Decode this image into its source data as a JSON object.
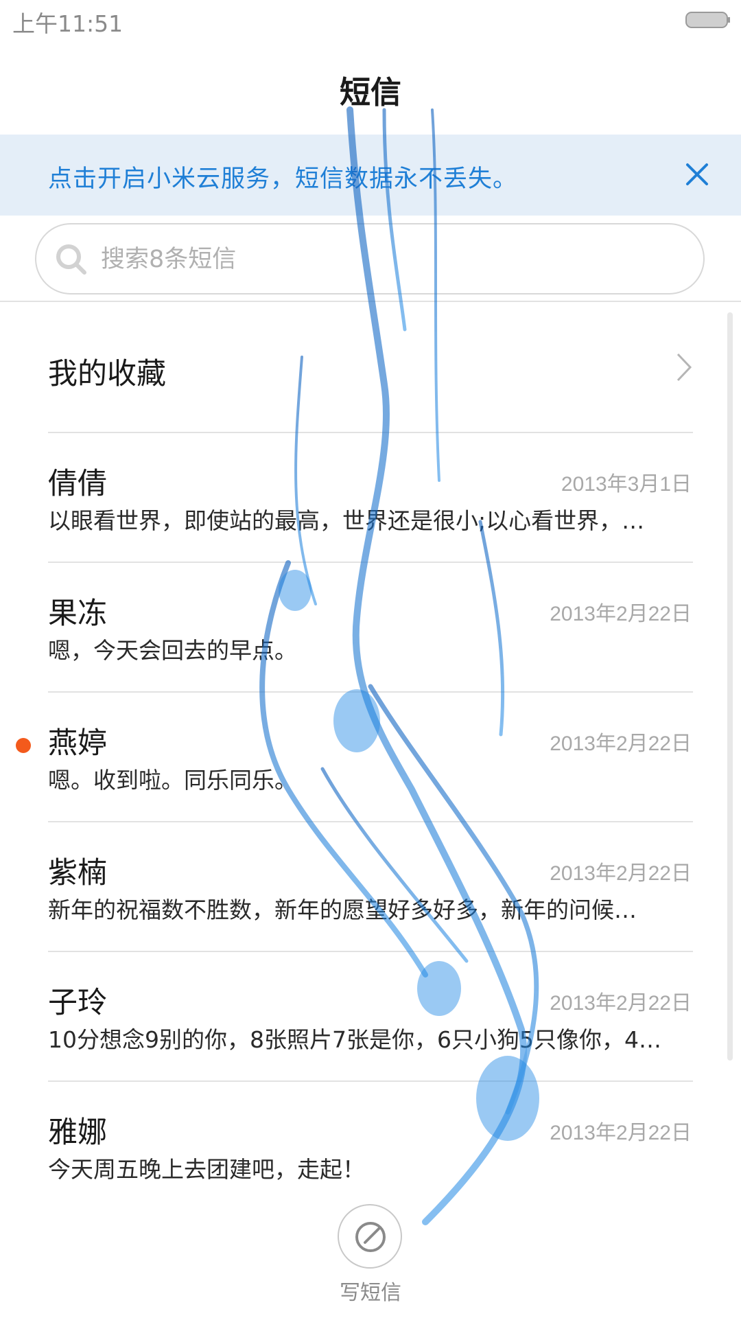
{
  "status_bar": {
    "time": "上午11:51",
    "battery_icon": "battery-icon"
  },
  "header": {
    "title": "短信"
  },
  "banner": {
    "text": "点击开启小米云服务，短信数据永不丢失。",
    "close_icon": "close-icon",
    "accent": "#1f7fd6",
    "background": "#e4eef8"
  },
  "search": {
    "placeholder": "搜索8条短信",
    "icon": "search-icon"
  },
  "favorites": {
    "label": "我的收藏",
    "icon": "chevron-right-icon"
  },
  "conversations": [
    {
      "name": "倩倩",
      "date": "2013年3月1日",
      "snippet": "以眼看世界，即使站的最高，世界还是很小;以心看世界，…",
      "unread": false
    },
    {
      "name": "果冻",
      "date": "2013年2月22日",
      "snippet": "嗯，今天会回去的早点。",
      "unread": false
    },
    {
      "name": "燕婷",
      "date": "2013年2月22日",
      "snippet": "嗯。收到啦。同乐同乐。",
      "unread": true
    },
    {
      "name": "紫楠",
      "date": "2013年2月22日",
      "snippet": "新年的祝福数不胜数，新年的愿望好多好多，新年的问候…",
      "unread": false
    },
    {
      "name": "子玲",
      "date": "2013年2月22日",
      "snippet": "10分想念9别的你，8张照片7张是你，6只小狗5只像你，4…",
      "unread": false
    },
    {
      "name": "雅娜",
      "date": "2013年2月22日",
      "snippet": "今天周五晚上去团建吧，走起！",
      "unread": false
    }
  ],
  "compose": {
    "label": "写短信",
    "icon": "compose-icon"
  },
  "colors": {
    "unread_dot": "#f35a1c",
    "ink": "#1e88e5"
  }
}
